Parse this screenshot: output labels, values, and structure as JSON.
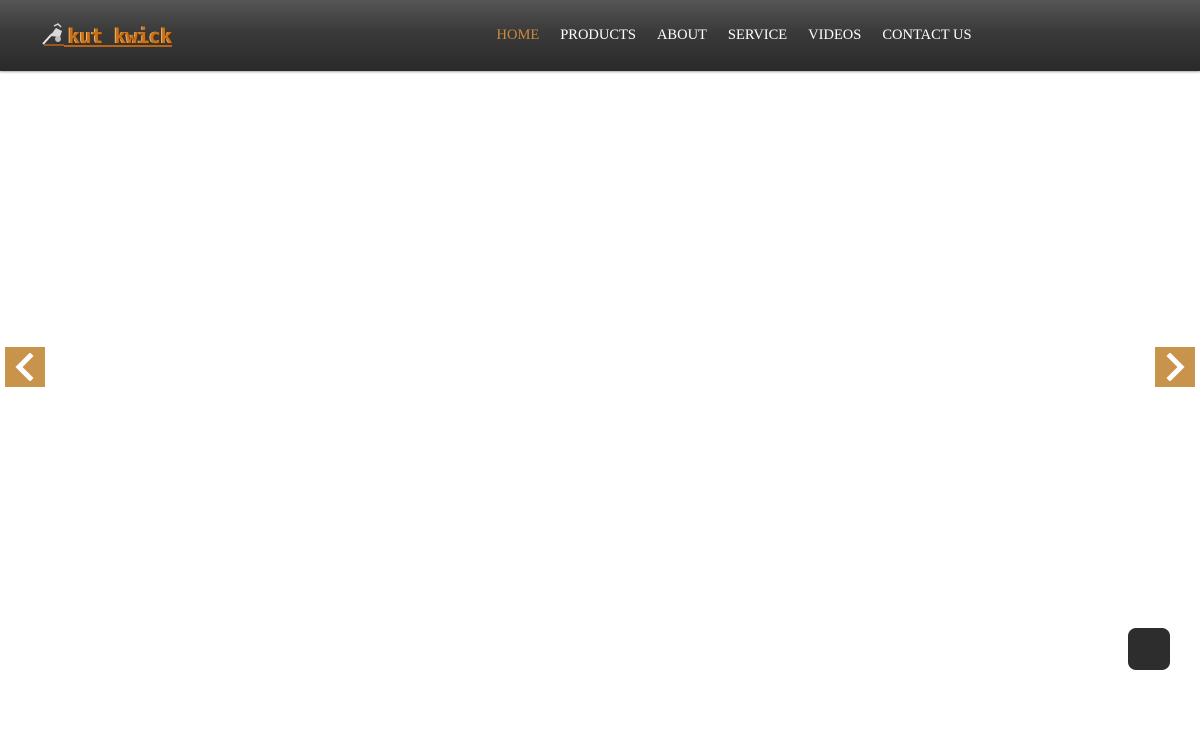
{
  "brand": {
    "logo_text": "kut kwick",
    "logo_color": "#c8731c"
  },
  "nav": {
    "items": [
      {
        "label": "HOME",
        "active": true
      },
      {
        "label": "PRODUCTS",
        "active": false
      },
      {
        "label": "ABOUT",
        "active": false
      },
      {
        "label": "SERVICE",
        "active": false
      },
      {
        "label": "VIDEOS",
        "active": false
      },
      {
        "label": "CONTACT US",
        "active": false
      }
    ],
    "active_color": "#c98a3c"
  },
  "slider": {
    "prev_icon": "chevron-left-icon",
    "next_icon": "chevron-right-icon",
    "arrow_color": "#c8934a"
  },
  "floating_button": {
    "color": "#2d2d2d"
  }
}
